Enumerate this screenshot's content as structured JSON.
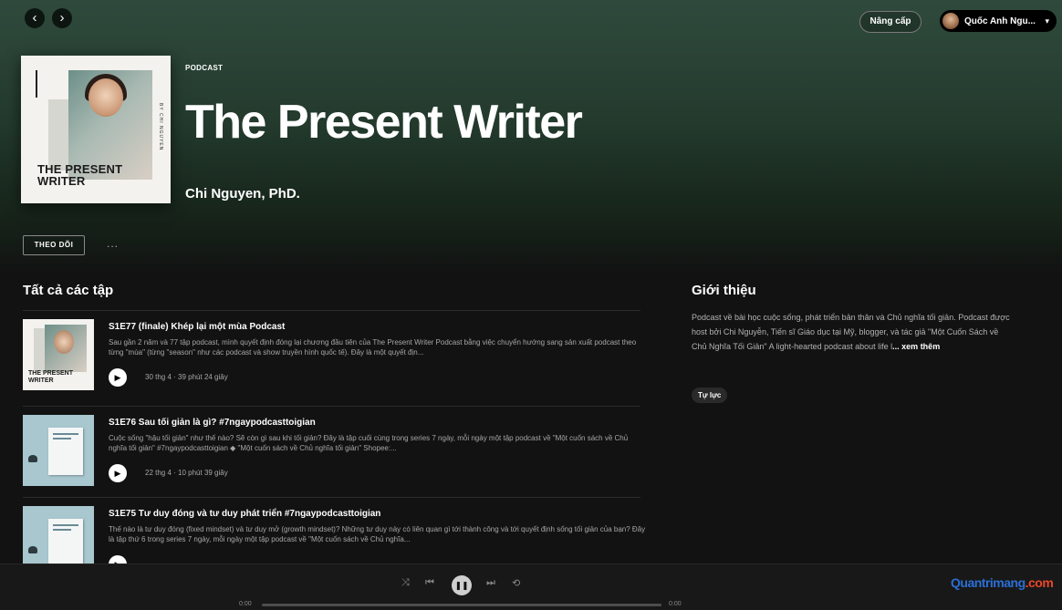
{
  "nav": {
    "back_glyph": "‹",
    "forward_glyph": "›"
  },
  "header": {
    "upgrade_label": "Nâng cấp",
    "user_name": "Quốc Anh Ngu...",
    "caret": "▾"
  },
  "podcast": {
    "kind": "PODCAST",
    "title": "The Present Writer",
    "author": "Chi Nguyen, PhD.",
    "cover_title_line1": "THE PRESENT",
    "cover_title_line2": "WRITER",
    "cover_side_text": "BY CHI NGUYEN"
  },
  "actions": {
    "follow_label": "THEO DÕI",
    "more_label": "..."
  },
  "episodes_section": {
    "title": "Tất cả các tập"
  },
  "episodes": [
    {
      "title": "S1E77 (finale) Khép lại một mùa Podcast",
      "description": "Sau gần 2 năm và 77 tập podcast, mình quyết định đóng lại chương đầu tiên của The Present Writer Podcast bằng việc chuyển hướng sang sản xuất podcast theo từng \"mùa\" (từng \"season\" như các podcast và show truyền hình quốc tế). Đây là một quyết địn...",
      "meta": "30 thg 4 · 39 phút 24 giây",
      "thumb_line1": "THE PRESENT",
      "thumb_line2": "WRITER"
    },
    {
      "title": "S1E76 Sau tối giản là gì? #7ngaypodcasttoigian",
      "description": "Cuộc sống \"hậu tối giản\" như thế nào? Sẽ còn gì sau khi tối giản? Đây là tập cuối cùng trong series 7 ngày, mỗi ngày một tập podcast về \"Một cuốn sách về Chủ nghĩa tối giản\" #7ngaypodcasttoigian ◆ \"Một cuốn sách về Chủ nghĩa tối giản\" Shopee:...",
      "meta": "22 thg 4 · 10 phút 39 giây"
    },
    {
      "title": "S1E75 Tư duy đóng và tư duy phát triển #7ngaypodcasttoigian",
      "description": "Thế nào là tư duy đóng (fixed mindset) và tư duy mở (growth mindset)? Những tư duy này có liên quan gì tới thành công và tới quyết định sống tối giản của bạn? Đây là tập thứ 6 trong series 7 ngày, mỗi ngày một tập podcast về \"Một cuốn sách về Chủ nghĩa...",
      "meta": ""
    }
  ],
  "about": {
    "title": "Giới thiệu",
    "description": "Podcast về bài học cuộc sống, phát triển bản thân và Chủ nghĩa tối giản. Podcast được host bởi Chi Nguyễn, Tiến sĩ Giáo dục tại Mỹ, blogger, và tác giả \"Một Cuốn Sách về Chủ Nghĩa Tối Giản\" A light-hearted podcast about life l",
    "see_more": "... xem thêm",
    "tag": "Tự lực"
  },
  "player": {
    "shuffle_glyph": "⤨",
    "prev_glyph": "⏮",
    "pause_glyph": "❚❚",
    "next_glyph": "⏭",
    "repeat_glyph": "⟲",
    "time_elapsed": "0:00",
    "time_total": "0:00",
    "progress": 0
  },
  "watermark": {
    "left": "Quantrimang",
    "right": ".com"
  },
  "colors": {
    "accent": "#1db954",
    "hero_top": "#2f4a3c",
    "background": "#121212"
  }
}
